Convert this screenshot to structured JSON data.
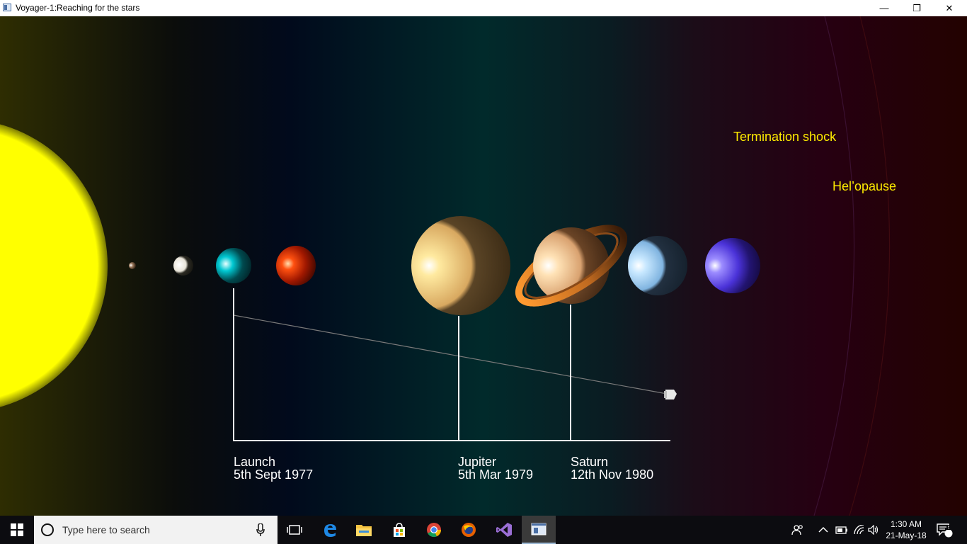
{
  "window": {
    "title": "Voyager-1:Reaching for the stars",
    "minimize_glyph": "—",
    "restore_glyph": "❐",
    "close_glyph": "✕"
  },
  "milestones": [
    {
      "name": "Launch",
      "date": "5th Sept 1977"
    },
    {
      "name": "Jupiter",
      "date": "5th Mar 1979"
    },
    {
      "name": "Saturn",
      "date": "12th Nov 1980"
    }
  ],
  "regions": {
    "termination_shock": "Termination shock",
    "heliopause": "Hel’opause"
  },
  "planets": [
    "mercury",
    "venus",
    "earth",
    "mars",
    "jupiter",
    "saturn",
    "uranus",
    "neptune"
  ],
  "taskbar": {
    "search_placeholder": "Type here to search",
    "apps": [
      "task-view",
      "edge",
      "file-explorer",
      "store",
      "chrome",
      "firefox",
      "visual-studio",
      "voyager-app"
    ]
  },
  "tray": {
    "time": "1:30 AM",
    "date": "21-May-18",
    "notification_count": "2"
  },
  "colors": {
    "sun": "#ffff00",
    "label_yellow": "#ffeb00",
    "timeline": "#ffffff"
  }
}
